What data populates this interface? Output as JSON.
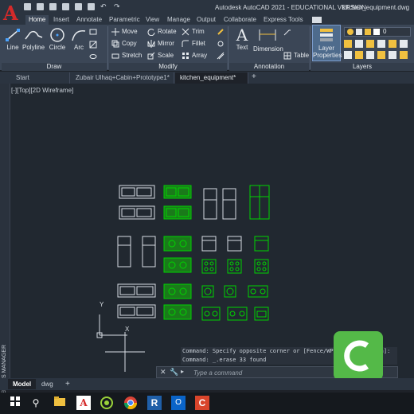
{
  "titlebar": {
    "app_letter": "A",
    "title": "Autodesk AutoCAD 2021 - EDUCATIONAL VERSION",
    "filename": "kitchen_equipment.dwg"
  },
  "ribbon_tabs": [
    "Home",
    "Insert",
    "Annotate",
    "Parametric",
    "View",
    "Manage",
    "Output",
    "Collaborate",
    "Express Tools"
  ],
  "draw_panel": {
    "label": "Draw",
    "tools": [
      "Line",
      "Polyline",
      "Circle",
      "Arc"
    ]
  },
  "modify_panel": {
    "label": "Modify",
    "row1": [
      "Move",
      "Rotate",
      "Trim"
    ],
    "row2": [
      "Copy",
      "Mirror",
      "Fillet"
    ],
    "row3": [
      "Stretch",
      "Scale",
      "Array"
    ]
  },
  "annotation_panel": {
    "label": "Annotation",
    "text": "Text",
    "dimension": "Dimension",
    "table": "Table"
  },
  "layers_panel": {
    "label": "Layers",
    "layer_properties_line1": "Layer",
    "layer_properties_line2": "Properties",
    "current_layer": "0"
  },
  "doc_tabs": {
    "start": "Start",
    "tab1": "Zubair Ulhaq+Cabin+Prototype1*",
    "tab2": "kitchen_equipment*"
  },
  "viewport_label": "[-][Top][2D Wireframe]",
  "side_palette": "LAYER PROPERTIES MANAGER",
  "command": {
    "history1": "Command: Specify opposite corner or [Fence/WPolygon/CPolygon]:",
    "history2": "Command: _.erase 33 found",
    "placeholder": "Type a command"
  },
  "layout_tabs": [
    "Model",
    "dwg"
  ],
  "ucs": {
    "y": "Y",
    "x": "X"
  },
  "colors": {
    "accent_green": "#00d400",
    "autocad_red": "#d42a2a",
    "ribbon_bg": "#3b4656",
    "canvas_bg": "#212830"
  },
  "taskbar_icons": [
    "windows-icon",
    "search-icon",
    "file-explorer-icon",
    "autocad-icon",
    "camtasia-recorder-icon",
    "chrome-icon",
    "revit-icon",
    "outlook-icon",
    "camtasia-icon"
  ]
}
